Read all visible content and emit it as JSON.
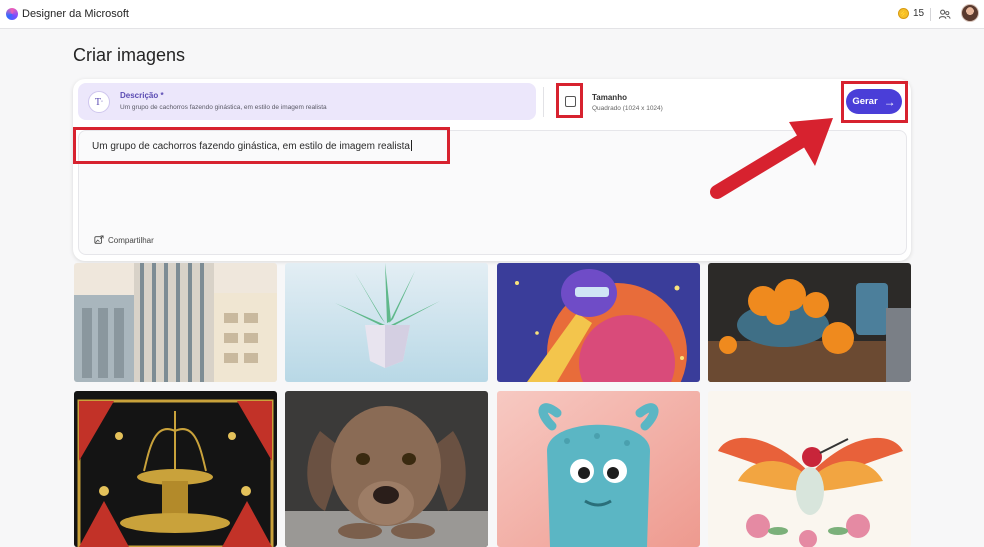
{
  "app": {
    "title": "Designer da Microsoft",
    "coins": "15",
    "logo_icon": "designer-logo-icon",
    "accent_color": "#4a3ed8"
  },
  "page": {
    "title": "Criar imagens"
  },
  "prompt_card": {
    "description_label": "Descrição *",
    "description_preview": "Um grupo de cachorros fazendo ginástica, em estilo de imagem realista",
    "size_label": "Tamanho",
    "size_value": "Quadrado (1024 x 1024)",
    "generate_label": "Gerar",
    "prompt_text": "Um grupo de cachorros fazendo ginástica, em estilo de imagem realista",
    "share_label": "Compartilhar"
  },
  "gallery": {
    "images": [
      {
        "subject": "art-deco-building"
      },
      {
        "subject": "paper-plant-vase"
      },
      {
        "subject": "astronaut-rocket"
      },
      {
        "subject": "oranges-bowl"
      },
      {
        "subject": "art-deco-fountain"
      },
      {
        "subject": "weimaraner-dog"
      },
      {
        "subject": "blue-monster-toy"
      },
      {
        "subject": "watercolor-hummingbird"
      }
    ]
  },
  "annotation_color": "#d7222f"
}
